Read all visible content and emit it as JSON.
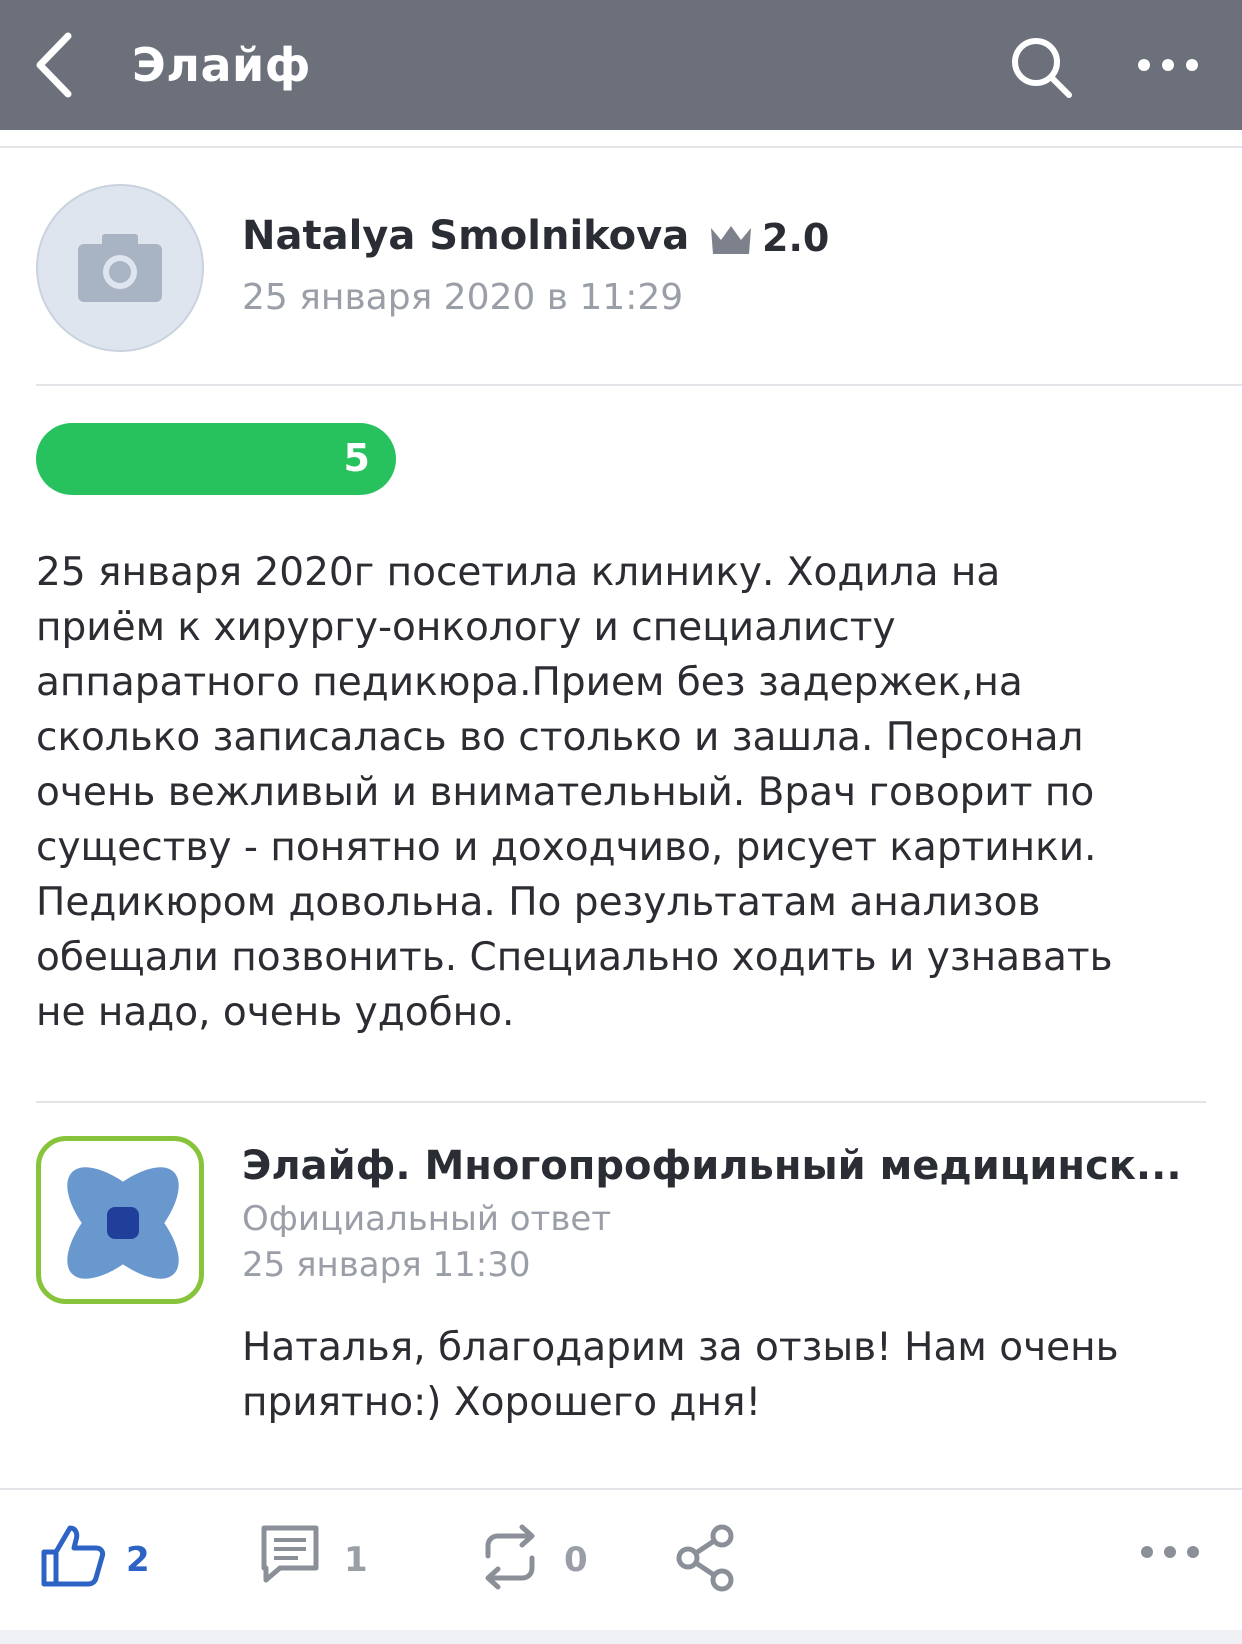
{
  "header": {
    "title": "Элайф",
    "back_icon": "chevron-left-icon",
    "search_icon": "search-icon",
    "more_icon": "more-horizontal-icon"
  },
  "review": {
    "author": "Natalya Smolnikova",
    "level": "2.0",
    "date": "25 января 2020 в 11:29",
    "score": "5",
    "score_color": "#27c15d",
    "text": "25 января 2020г посетила клинику. Ходила на\nприём к хирургу-онкологу и специалисту\nаппаратного педикюра.Прием без задержек,на\nсколько записалась во столько и зашла. Персонал\nочень вежливый и внимательный. Врач говорит по\nсуществу - понятно и доходчиво, рисует картинки.\nПедикюром довольна. По результатам анализов\nобещали позвонить. Специально ходить и узнавать\nне надо, очень удобно."
  },
  "official_reply": {
    "company": "Элайф. Многопрофильный медицинск...",
    "label": "Официальный ответ",
    "date": "25 января 11:30",
    "text": "Наталья, благодарим за отзыв! Нам очень\nприятно:) Хорошего дня!"
  },
  "actions": {
    "likes": "2",
    "comments": "1",
    "reposts": "0",
    "like_color": "#2e63c6"
  },
  "colors": {
    "header_bg": "#6b707a",
    "logo_border": "#88c43b",
    "logo_petal": "#4f86c6",
    "logo_center": "#1f3f9a"
  }
}
